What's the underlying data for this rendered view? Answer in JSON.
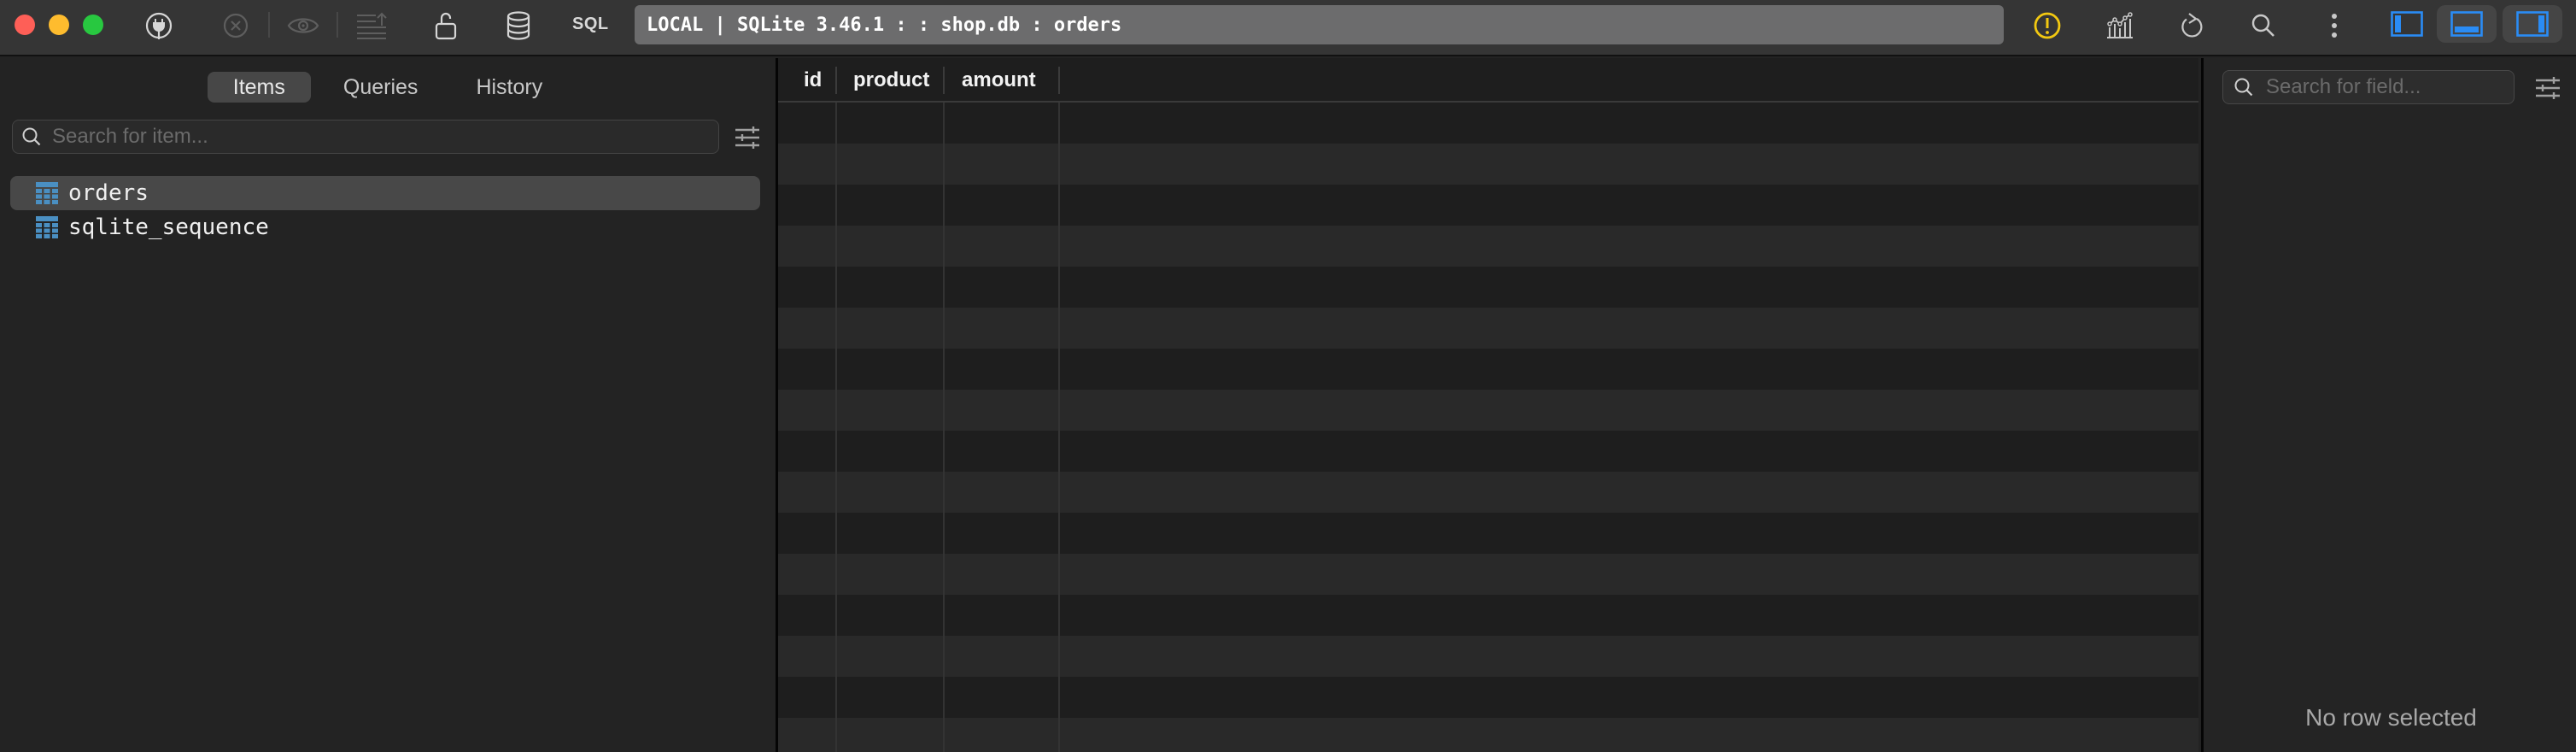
{
  "window": {
    "traffic_lights": [
      "close",
      "minimize",
      "maximize"
    ]
  },
  "toolbar": {
    "icons": {
      "connection": "plug-icon",
      "stop": "x-circle-icon",
      "preview": "eye-icon",
      "sort": "list-sort-icon",
      "lock": "unlocked-icon",
      "database": "database-icon",
      "warning": "warning-icon",
      "metrics": "chart-icon",
      "reload": "refresh-icon",
      "search": "search-icon",
      "more": "more-vertical-icon"
    },
    "sql_label": "SQL",
    "address": "LOCAL | SQLite 3.46.1 :  : shop.db : orders",
    "warning_color": "#f2c811",
    "accent_color": "#2a8cf5",
    "layout_toggles": [
      "toggle-left-sidebar",
      "toggle-bottom-panel",
      "toggle-right-panel"
    ]
  },
  "sidebar": {
    "tabs": [
      {
        "label": "Items",
        "active": true
      },
      {
        "label": "Queries",
        "active": false
      },
      {
        "label": "History",
        "active": false
      }
    ],
    "search": {
      "placeholder": "Search for item...",
      "value": ""
    },
    "items": [
      {
        "label": "orders",
        "type": "table",
        "selected": true
      },
      {
        "label": "sqlite_sequence",
        "type": "table",
        "selected": false
      }
    ]
  },
  "grid": {
    "columns": [
      "id",
      "product",
      "amount"
    ],
    "rows": []
  },
  "detail_panel": {
    "search": {
      "placeholder": "Search for field...",
      "value": ""
    },
    "empty_message": "No row selected"
  }
}
